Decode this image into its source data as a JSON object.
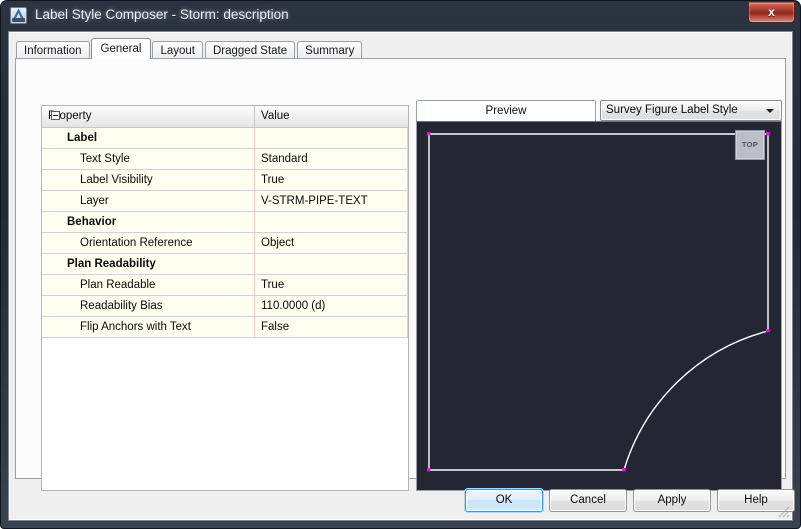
{
  "window": {
    "title": "Label Style Composer - Storm: description",
    "app_icon": "autocad-a-icon",
    "close_label": "x"
  },
  "tabs": [
    {
      "label": "Information",
      "active": false
    },
    {
      "label": "General",
      "active": true
    },
    {
      "label": "Layout",
      "active": false
    },
    {
      "label": "Dragged State",
      "active": false
    },
    {
      "label": "Summary",
      "active": false
    }
  ],
  "property_grid": {
    "headers": {
      "property": "Property",
      "value": "Value"
    },
    "rows": [
      {
        "type": "group",
        "label": "Label",
        "value": "",
        "expanded": true
      },
      {
        "type": "item",
        "label": "Text Style",
        "value": "Standard"
      },
      {
        "type": "item",
        "label": "Label Visibility",
        "value": "True"
      },
      {
        "type": "item",
        "label": "Layer",
        "value": "V-STRM-PIPE-TEXT"
      },
      {
        "type": "group",
        "label": "Behavior",
        "value": "",
        "expanded": true
      },
      {
        "type": "item",
        "label": "Orientation Reference",
        "value": "Object"
      },
      {
        "type": "group",
        "label": "Plan Readability",
        "value": "",
        "expanded": true
      },
      {
        "type": "item",
        "label": "Plan Readable",
        "value": "True"
      },
      {
        "type": "item",
        "label": "Readability Bias",
        "value": "110.0000 (d)"
      },
      {
        "type": "item",
        "label": "Flip Anchors with Text",
        "value": "False"
      }
    ]
  },
  "preview": {
    "label": "Preview",
    "style_selected": "Survey Figure Label Style",
    "viewcube_label": "TOP",
    "canvas_background": "#222733",
    "geometry_color": "#ffffff",
    "grip_color": "#ff00ff"
  },
  "buttons": {
    "ok": "OK",
    "cancel": "Cancel",
    "apply": "Apply",
    "help": "Help"
  }
}
